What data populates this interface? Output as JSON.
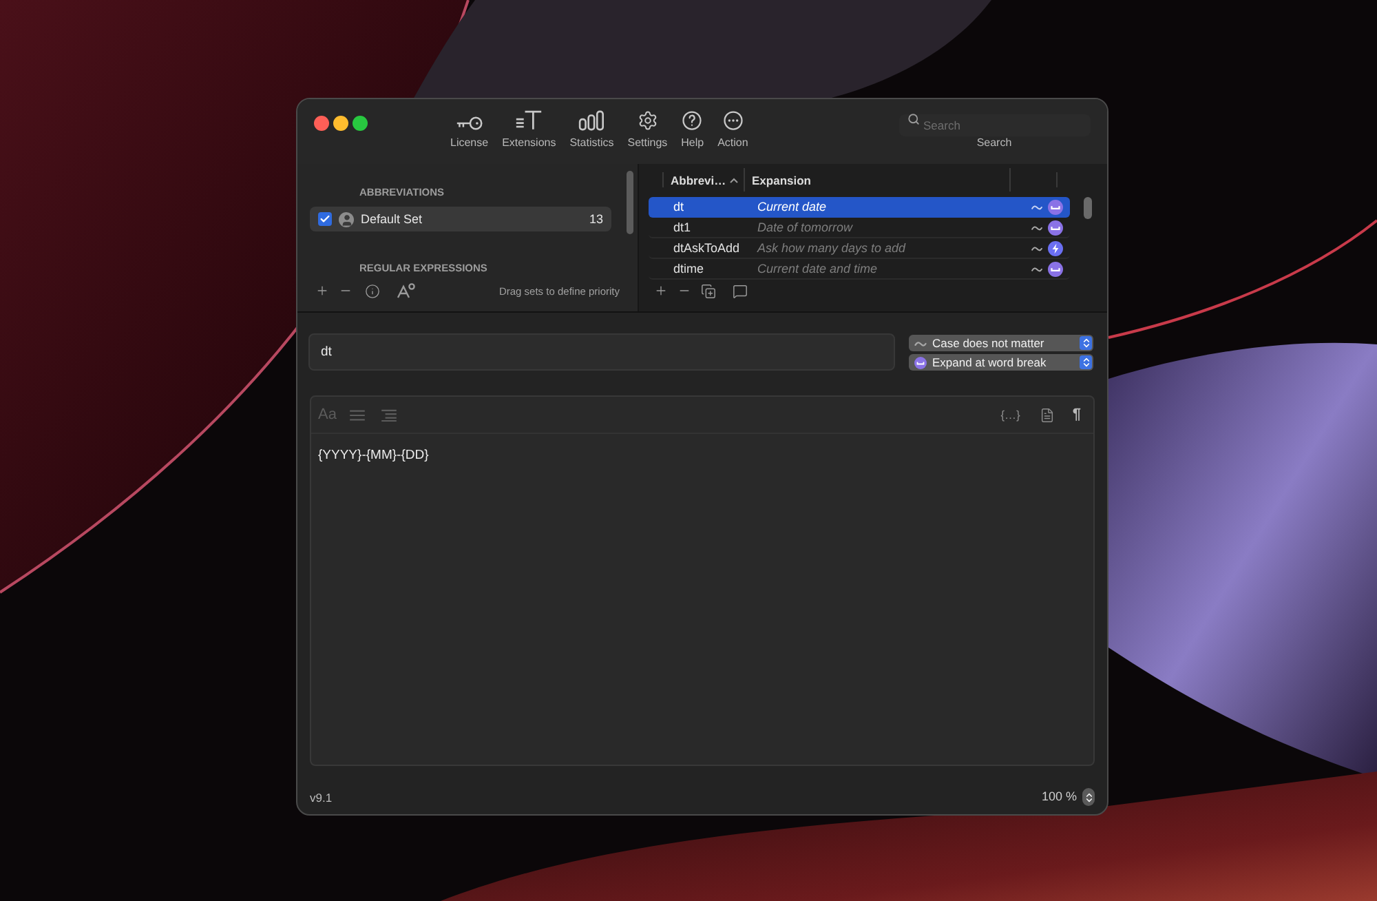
{
  "toolbar": {
    "items": [
      {
        "label": "License"
      },
      {
        "label": "Extensions"
      },
      {
        "label": "Statistics"
      },
      {
        "label": "Settings"
      },
      {
        "label": "Help"
      },
      {
        "label": "Action"
      }
    ],
    "search": {
      "placeholder": "Search",
      "label": "Search"
    }
  },
  "sets_panel": {
    "sections": [
      {
        "heading": "ABBREVIATIONS",
        "items": [
          {
            "label": "Default Set",
            "checked": true,
            "selected": true,
            "count": "13"
          }
        ]
      },
      {
        "heading": "REGULAR EXPRESSIONS"
      }
    ],
    "hint": "Drag sets to define priority"
  },
  "abbreviation_table": {
    "columns": [
      {
        "label": "Abbrevi…",
        "sorted": true
      },
      {
        "label": "Expansion",
        "sorted": false
      }
    ],
    "rows": [
      {
        "abbreviation": "dt",
        "expansion": "Current date",
        "selected": true,
        "case_insensitive": true,
        "kind": "word_break"
      },
      {
        "abbreviation": "dt1",
        "expansion": "Date of tomorrow",
        "selected": false,
        "case_insensitive": true,
        "kind": "word_break"
      },
      {
        "abbreviation": "dtAskToAdd",
        "expansion": "Ask how many days to add",
        "selected": false,
        "case_insensitive": true,
        "kind": "instant"
      },
      {
        "abbreviation": "dtime",
        "expansion": "Current date and time",
        "selected": false,
        "case_insensitive": true,
        "kind": "word_break"
      }
    ]
  },
  "entry": {
    "abbreviation": "dt",
    "case_option": "Case does not matter",
    "expand_option": "Expand at word break"
  },
  "editor": {
    "font_button": "Aa",
    "format_disabled": true,
    "snippet_button": "{…}",
    "paragraph_button": "¶",
    "content": "{YYYY}-{MM}-{DD}"
  },
  "footer": {
    "version": "v9.1",
    "zoom": "100 %"
  }
}
